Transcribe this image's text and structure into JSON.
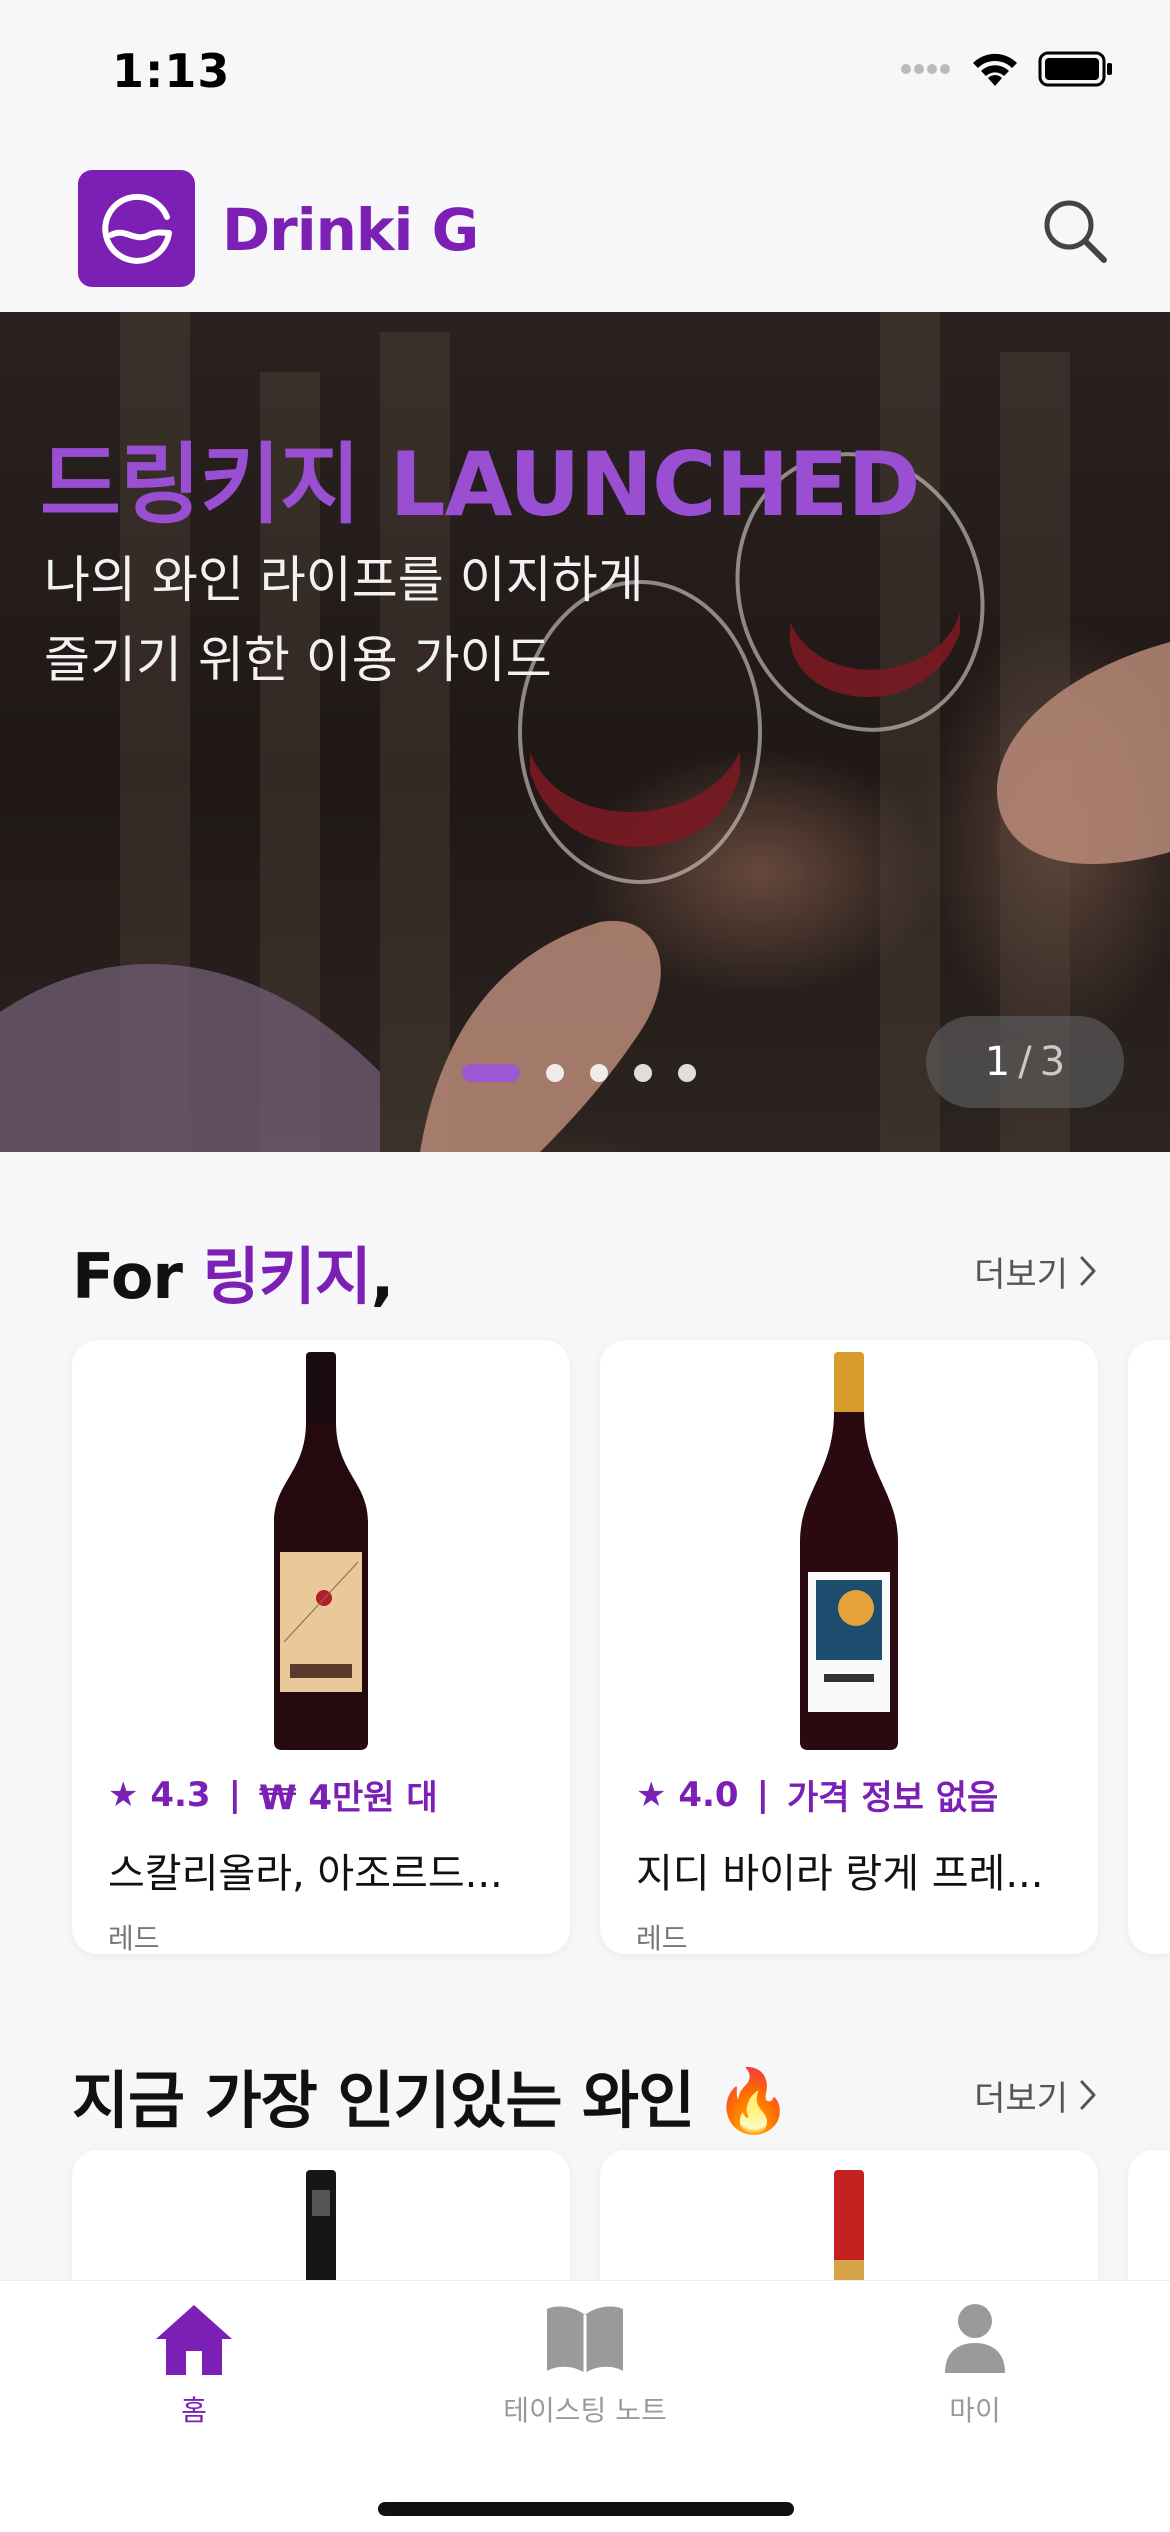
{
  "status_bar": {
    "time": "1:13"
  },
  "header": {
    "app_name": "Drinki G"
  },
  "banner": {
    "title": "드링키지 LAUNCHED",
    "subtitle_line1": "나의 와인 라이프를 이지하게",
    "subtitle_line2": "즐기기 위한 이용 가이드",
    "counter_current": "1",
    "counter_sep": "/",
    "counter_total": "3",
    "dot_count": 5,
    "active_dot": 1
  },
  "section_recommend": {
    "title_prefix": "For ",
    "title_name": "링키지",
    "title_suffix": ",",
    "more_label": "더보기",
    "cards": [
      {
        "rating": "★ 4.3",
        "sep": "|",
        "price": "₩ 4만원 대",
        "name": "스칼리올라, 아조르드...",
        "type": "레드"
      },
      {
        "rating": "★ 4.0",
        "sep": "|",
        "price": "가격 정보 없음",
        "name": "지디 바이라 랑게 프레...",
        "type": "레드"
      }
    ]
  },
  "section_popular": {
    "title": "지금 가장 인기있는 와인 🔥",
    "more_label": "더보기"
  },
  "tabs": [
    {
      "label": "홈",
      "icon": "home-icon",
      "active": true
    },
    {
      "label": "테이스팅 노트",
      "icon": "book-icon",
      "active": false
    },
    {
      "label": "마이",
      "icon": "person-icon",
      "active": false
    }
  ],
  "colors": {
    "accent": "#7b1fb5",
    "inactive": "#9a9a9a"
  }
}
